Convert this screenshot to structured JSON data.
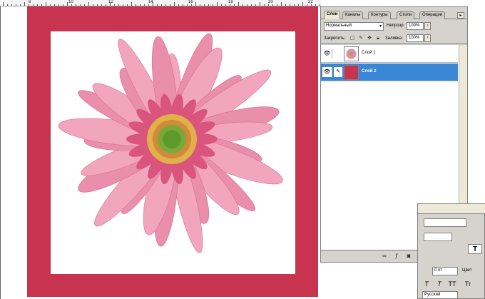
{
  "ruler": {
    "labels": [
      "8",
      "10",
      "12",
      "14",
      "16",
      "18",
      "20",
      "22"
    ]
  },
  "layers_panel": {
    "tabs": [
      "Слои",
      "Каналы",
      "Контуры",
      "Стили",
      "Операции"
    ],
    "menu_icon": "panel-menu-icon",
    "blend_mode": "Нормальный",
    "opacity_label": "Непрозр:",
    "opacity_value": "100%",
    "lock_label": "Закрепить:",
    "fill_label": "Заливка:",
    "fill_value": "100%",
    "layers": [
      {
        "name": "Слой 1",
        "selected": false
      },
      {
        "name": "Слой 2",
        "selected": true
      }
    ],
    "bottom_icons": [
      "link-icon",
      "layer-style-icon",
      "mask-icon",
      "adjustment-icon",
      "folder-icon",
      "new-layer-icon",
      "trash-icon"
    ]
  },
  "character_panel": {
    "size_value": "0 пт",
    "color_label": "Цвет",
    "language": "Русский",
    "style_buttons": [
      "T",
      "T",
      "TT",
      "Tr"
    ]
  },
  "colors": {
    "frame": "#c8334f",
    "selection": "#3a87d8",
    "panel": "#d6d3ce"
  }
}
